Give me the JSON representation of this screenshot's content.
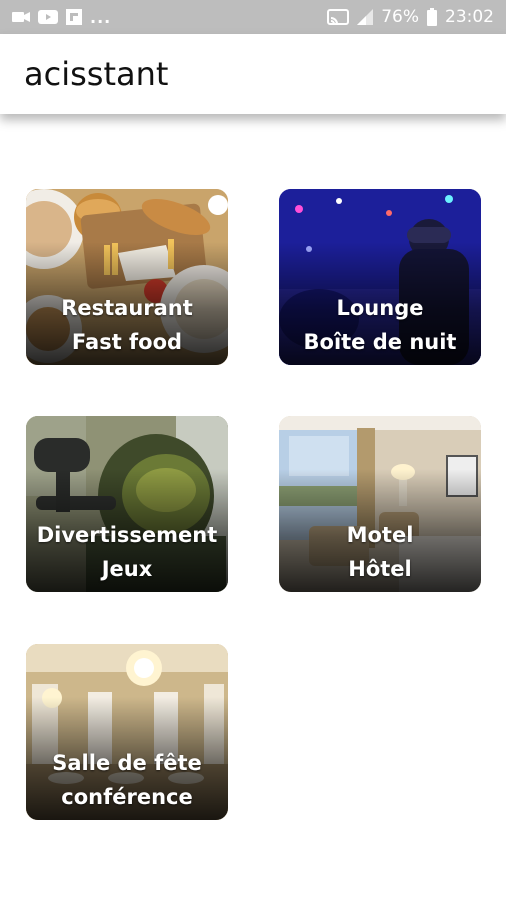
{
  "status_bar": {
    "overflow_dots": "...",
    "battery_percent": "76%",
    "time": "23:02",
    "icons": [
      "video-camera-icon",
      "youtube-icon",
      "flipboard-icon",
      "cast-icon",
      "signal-icon",
      "battery-icon"
    ]
  },
  "app_bar": {
    "title": "acisstant"
  },
  "categories": [
    {
      "line1": "Restaurant",
      "line2": "Fast food"
    },
    {
      "line1": "Lounge",
      "line2": "Boîte de nuit"
    },
    {
      "line1": "Divertissement",
      "line2": "Jeux"
    },
    {
      "line1": "Motel",
      "line2": "Hôtel"
    },
    {
      "line1": "Salle de fête",
      "line2": "conférence"
    }
  ],
  "colors": {
    "status_bar": "#bdbdbd",
    "app_bar": "#ffffff",
    "title_text": "#111111",
    "card_label": "#ffffff"
  }
}
